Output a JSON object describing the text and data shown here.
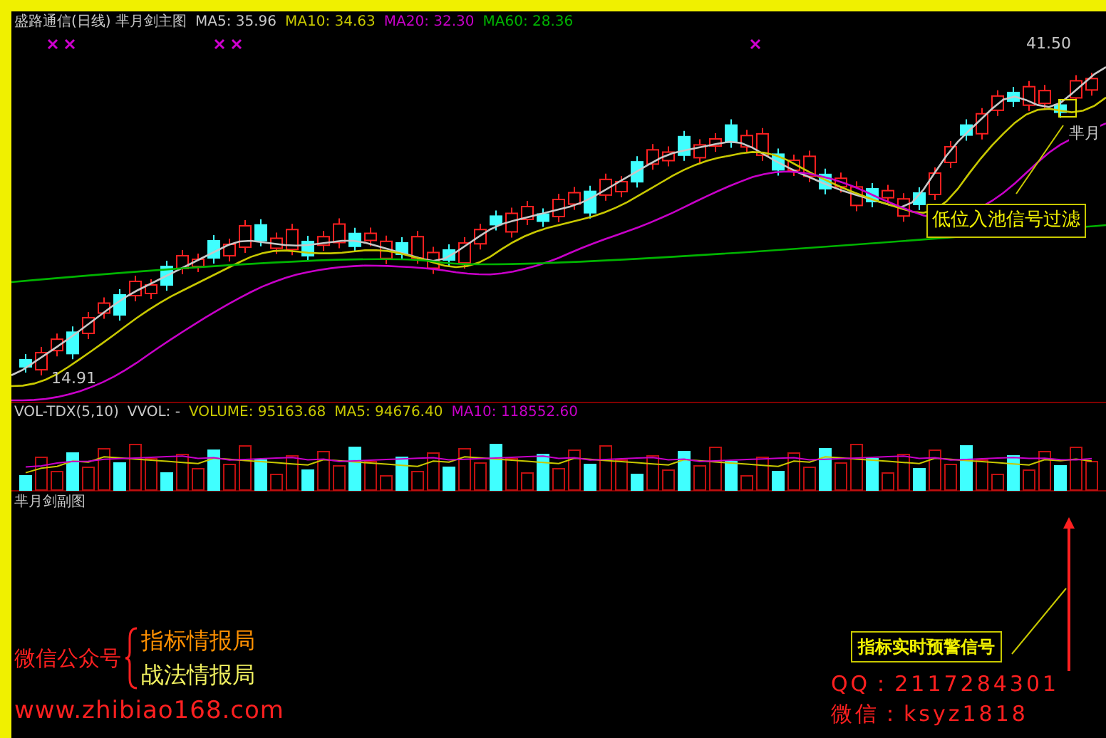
{
  "main_chart": {
    "title": "盛路通信(日线) 芈月剑主图",
    "legend": [
      {
        "label": "MA5: 35.96",
        "color": "#c8c8c8"
      },
      {
        "label": "MA10: 34.63",
        "color": "#c8c800"
      },
      {
        "label": "MA20: 32.30",
        "color": "#c800c8"
      },
      {
        "label": "MA60: 28.36",
        "color": "#00b400"
      }
    ],
    "high_label": "41.50",
    "low_label": "14.91",
    "signal_label": "芈月",
    "callout": "低位入池信号过滤"
  },
  "volume_chart": {
    "legend": [
      {
        "label": "VOL-TDX(5,10)",
        "color": "#c8c8c8"
      },
      {
        "label": "VVOL: -",
        "color": "#c8c8c8"
      },
      {
        "label": "VOLUME: 95163.68",
        "color": "#c8c800"
      },
      {
        "label": "MA5: 94676.40",
        "color": "#c8c800"
      },
      {
        "label": "MA10: 118552.60",
        "color": "#c800c8"
      }
    ]
  },
  "sub_chart": {
    "title": "芈月剑副图",
    "callout": "指标实时预警信号"
  },
  "promo": {
    "account_label": "微信公众号",
    "accounts": [
      "指标情报局",
      "战法情报局"
    ],
    "website": "www.zhibiao168.com",
    "qq": "QQ：2117284301",
    "wechat": "微信：ksyz1818"
  }
}
